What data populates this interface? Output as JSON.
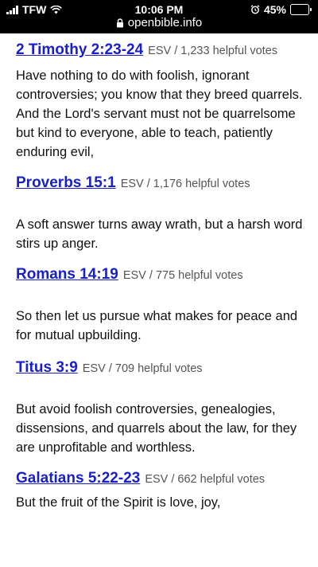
{
  "status_bar": {
    "carrier": "TFW",
    "time": "10:06 PM",
    "battery": "45%",
    "battery_level": 0.45,
    "icons": [
      "signal-icon",
      "wifi-icon",
      "alarm-icon",
      "battery-icon"
    ]
  },
  "url_bar": {
    "domain": "openbible.info",
    "icon": "lock-icon"
  },
  "colors": {
    "link": "#1a20c9",
    "meta": "#555555",
    "text": "#111111",
    "topbar": "#000000"
  },
  "verses": [
    {
      "reference": "2 Timothy 2:23-24",
      "meta": "ESV / 1,233 helpful votes",
      "text": "Have nothing to do with foolish, ignorant controversies; you know that they breed quarrels. And the Lord's servant must not be quarrelsome but kind to everyone, able to teach, patiently enduring evil,"
    },
    {
      "reference": "Proverbs 15:1",
      "meta": "ESV / 1,176 helpful votes",
      "text": "A soft answer turns away wrath, but a harsh word stirs up anger."
    },
    {
      "reference": "Romans 14:19",
      "meta": "ESV / 775 helpful votes",
      "text": "So then let us pursue what makes for peace and for mutual upbuilding."
    },
    {
      "reference": "Titus 3:9",
      "meta": "ESV / 709 helpful votes",
      "text": "But avoid foolish controversies, genealogies, dissensions, and quarrels about the law, for they are unprofitable and worthless."
    },
    {
      "reference": "Galatians 5:22-23",
      "meta": "ESV / 662 helpful votes",
      "text": "But the fruit of the Spirit is love, joy,"
    }
  ]
}
